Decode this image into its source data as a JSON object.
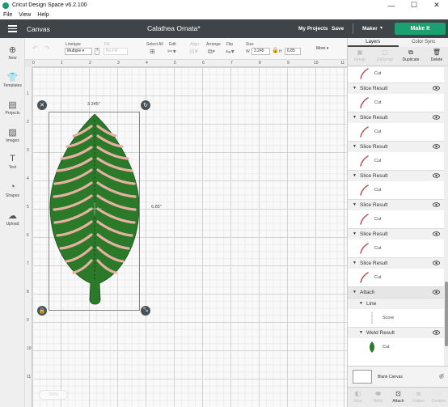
{
  "titlebar": {
    "title": "Cricut Design Space  v6.2.100",
    "minimize": "—",
    "maximize": "☐",
    "close": "✕"
  },
  "menu": [
    "File",
    "View",
    "Help"
  ],
  "header": {
    "canvas_label": "Canvas",
    "project_name": "Calathea Ornata*",
    "my_projects": "My Projects",
    "save": "Save",
    "machine": "Maker",
    "make_it": "Make It",
    "accent": "#1aa071",
    "bg": "#3f4449"
  },
  "toolbar": {
    "undo": "↶",
    "redo": "↷",
    "linetype_label": "Linetype",
    "linetype_value": "Multiple",
    "fill_label": "Fill",
    "fill_value": "No Fill",
    "select_all": "Select All",
    "edit": "Edit",
    "align": "Align",
    "arrange": "Arrange",
    "flip": "Flip",
    "size": "Size",
    "w_label": "W",
    "w_value": "3.245",
    "h_label": "H",
    "h_value": "6.85",
    "more": "More ▾"
  },
  "leftbar": [
    {
      "label": "New",
      "icon": "plus-icon"
    },
    {
      "label": "Templates",
      "icon": "shirt-icon"
    },
    {
      "label": "Projects",
      "icon": "projects-icon"
    },
    {
      "label": "Images",
      "icon": "images-icon"
    },
    {
      "label": "Text",
      "icon": "text-icon"
    },
    {
      "label": "Shapes",
      "icon": "shapes-icon"
    },
    {
      "label": "Upload",
      "icon": "upload-icon"
    }
  ],
  "rulers": {
    "top": [
      "0",
      "1",
      "2",
      "3",
      "4",
      "5",
      "6",
      "7",
      "8",
      "9",
      "10",
      "11"
    ],
    "left": [
      "1",
      "2",
      "3",
      "4",
      "5",
      "6",
      "7",
      "8",
      "9",
      "10",
      "11"
    ]
  },
  "selection": {
    "width_label": "3.245\"",
    "height_label": "6.85\""
  },
  "zoom": "100%",
  "rightpanel": {
    "tabs": [
      "Layers",
      "Color Sync"
    ],
    "actions": [
      "Group",
      "UnGroup",
      "Duplicate",
      "Delete"
    ],
    "layers": [
      {
        "type": "cut",
        "label": "Cut"
      },
      {
        "type": "group",
        "label": "Slice Result"
      },
      {
        "type": "cut",
        "label": "Cut"
      },
      {
        "type": "group",
        "label": "Slice Result"
      },
      {
        "type": "cut",
        "label": "Cut"
      },
      {
        "type": "group",
        "label": "Slice Result"
      },
      {
        "type": "cut",
        "label": "Cut"
      },
      {
        "type": "group",
        "label": "Slice Result"
      },
      {
        "type": "cut",
        "label": "Cut"
      },
      {
        "type": "group",
        "label": "Slice Result"
      },
      {
        "type": "cut",
        "label": "Cut"
      },
      {
        "type": "group",
        "label": "Slice Result"
      },
      {
        "type": "cut",
        "label": "Cut"
      },
      {
        "type": "group",
        "label": "Slice Result"
      },
      {
        "type": "cut",
        "label": "Cut"
      }
    ],
    "attach": {
      "label": "Attach",
      "line_label": "Line",
      "score_label": "Score",
      "weld_label": "Weld Result",
      "weld_cut_label": "Cut"
    },
    "blank_canvas": "Blank Canvas",
    "bottom_actions": [
      "Slice",
      "Weld",
      "Attach",
      "Flatten",
      "Contour"
    ]
  },
  "colors": {
    "leaf_green": "#2a7a2a",
    "leaf_pink": "#e8b0a0",
    "stripe": "#b85a5a"
  }
}
